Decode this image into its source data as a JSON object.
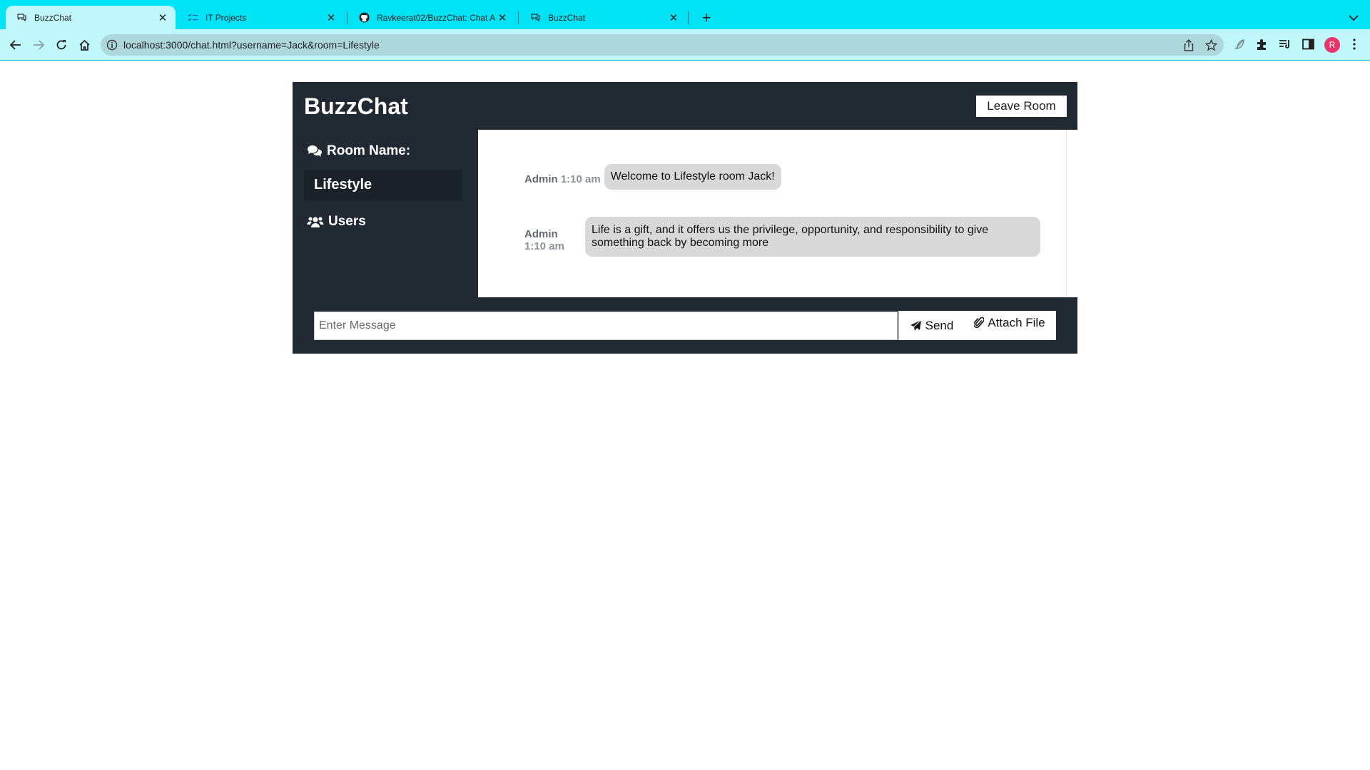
{
  "browser": {
    "tabs": [
      {
        "title": "BuzzChat",
        "active": true
      },
      {
        "title": "IT Projects",
        "active": false
      },
      {
        "title": "Ravkeerat02/BuzzChat: Chat A",
        "active": false
      },
      {
        "title": "BuzzChat",
        "active": false
      }
    ],
    "url": "localhost:3000/chat.html?username=Jack&room=Lifestyle",
    "profile_initial": "R",
    "accent_color": "#00e3f5"
  },
  "page": {
    "brand": "BuzzChat",
    "leave_button": "Leave Room",
    "sidebar": {
      "room_heading": "Room Name:",
      "room_name": "Lifestyle",
      "users_heading": "Users"
    },
    "messages": [
      {
        "user": "Admin",
        "time": "1:10 am",
        "text": "Welcome to Lifestyle room Jack!"
      },
      {
        "user": "Admin",
        "time": "1:10 am",
        "text": "Life is a gift, and it offers us the privilege, opportunity, and responsibility to give something back by becoming more"
      }
    ],
    "form": {
      "placeholder": "Enter Message",
      "send_label": "Send",
      "attach_label": "Attach File"
    },
    "colors": {
      "panel": "#212a33",
      "bubble": "#d9d9d9"
    }
  }
}
